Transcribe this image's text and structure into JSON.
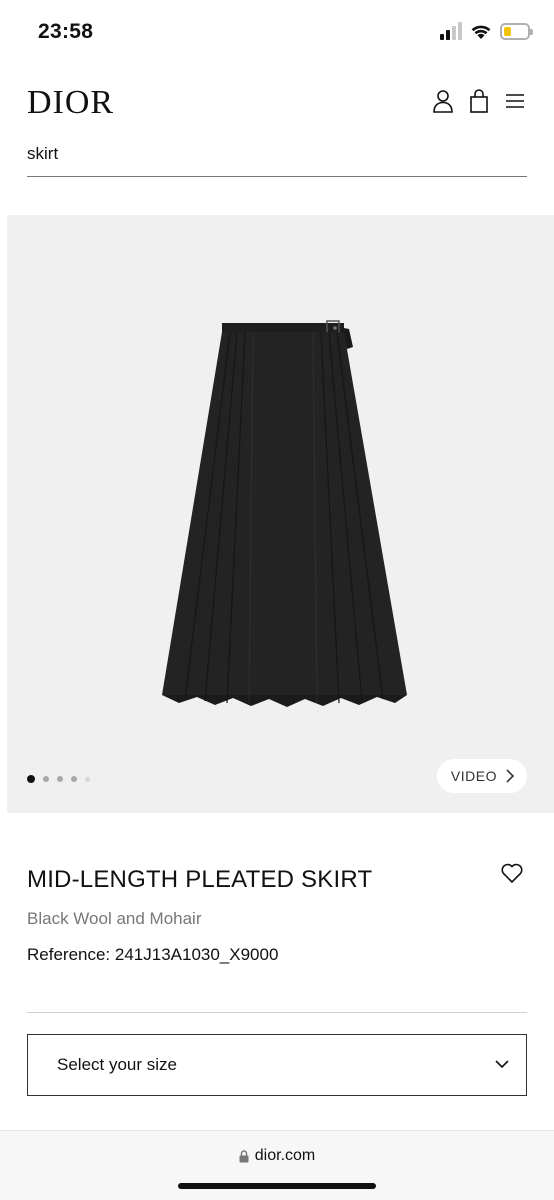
{
  "status_bar": {
    "time": "23:58"
  },
  "header": {
    "logo": "DIOR",
    "icons": [
      "user-icon",
      "shopping-bag-icon",
      "menu-icon"
    ]
  },
  "search": {
    "value": "skirt"
  },
  "gallery": {
    "image_description": "black pleated skirt",
    "dot_count": 4,
    "active_dot": 0,
    "video_label": "VIDEO"
  },
  "product": {
    "title": "MID-LENGTH PLEATED SKIRT",
    "subtitle": "Black Wool and Mohair",
    "reference": "Reference: 241J13A1030_X9000"
  },
  "size_selector": {
    "label": "Select your size"
  },
  "url_bar": {
    "domain": "dior.com"
  },
  "colors": {
    "background": "#ffffff",
    "image_background": "#f0f0f0",
    "text": "#111111",
    "muted": "#777777",
    "battery": "#f2c300"
  }
}
